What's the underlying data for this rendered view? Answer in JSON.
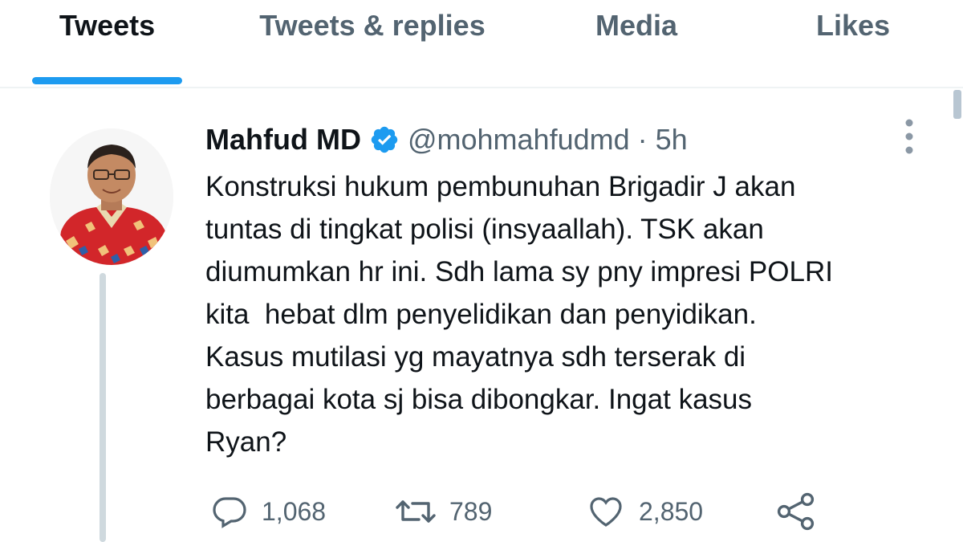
{
  "tabs": [
    {
      "label": "Tweets",
      "active": true
    },
    {
      "label": "Tweets & replies",
      "active": false
    },
    {
      "label": "Media",
      "active": false
    },
    {
      "label": "Likes",
      "active": false
    }
  ],
  "tweet": {
    "author_name": "Mahfud MD",
    "verified": true,
    "handle": "@mohmahfudmd",
    "separator": "·",
    "time": "5h",
    "text_lines": [
      "Konstruksi hukum pembunuhan Brigadir J akan",
      "tuntas di tingkat polisi (insyaallah). TSK akan",
      "diumumkan hr ini. Sdh lama sy pny impresi POLRI",
      "kita  hebat dlm penyelidikan dan penyidikan.",
      "Kasus mutilasi yg mayatnya sdh terserak di",
      "berbagai kota sj bisa dibongkar. Ingat kasus",
      "Ryan?"
    ],
    "stats": {
      "replies": "1,068",
      "retweets": "789",
      "likes": "2,850"
    }
  },
  "icons": {
    "verified": "verified-badge-icon",
    "more": "more-vertical-icon",
    "reply": "reply-icon",
    "retweet": "retweet-icon",
    "like": "heart-icon",
    "share": "share-icon"
  },
  "colors": {
    "accent": "#1d9bf0",
    "text_primary": "#0f1419",
    "text_secondary": "#536471",
    "divider": "#eff3f4"
  }
}
